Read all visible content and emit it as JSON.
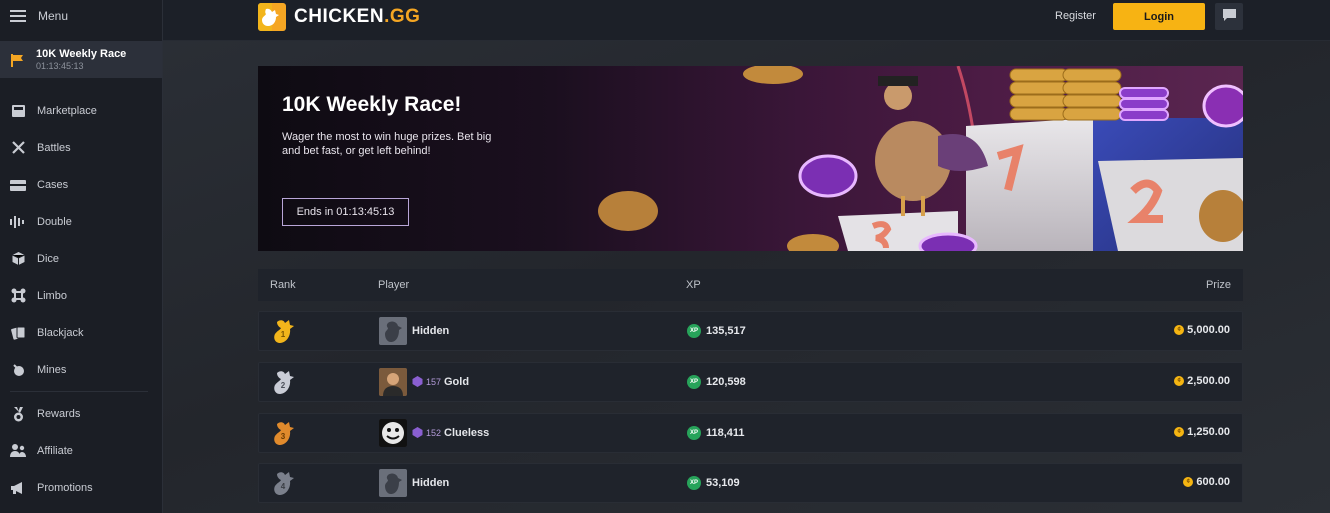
{
  "sidebar": {
    "menu_label": "Menu",
    "race": {
      "title": "10K Weekly Race",
      "timer": "01:13:45:13"
    },
    "items": [
      {
        "label": "Marketplace",
        "icon": "marketplace-icon"
      },
      {
        "label": "Battles",
        "icon": "swords-icon"
      },
      {
        "label": "Cases",
        "icon": "case-icon"
      },
      {
        "label": "Double",
        "icon": "bars-icon"
      },
      {
        "label": "Dice",
        "icon": "dice-icon"
      },
      {
        "label": "Limbo",
        "icon": "limbo-icon"
      },
      {
        "label": "Blackjack",
        "icon": "cards-icon"
      },
      {
        "label": "Mines",
        "icon": "mine-icon"
      }
    ],
    "items2": [
      {
        "label": "Rewards",
        "icon": "medal-icon"
      },
      {
        "label": "Affiliate",
        "icon": "people-icon"
      },
      {
        "label": "Promotions",
        "icon": "megaphone-icon"
      }
    ]
  },
  "header": {
    "logo_text": "CHICKEN",
    "logo_suffix": ".GG",
    "register_label": "Register",
    "login_label": "Login"
  },
  "banner": {
    "title": "10K Weekly Race!",
    "description": "Wager the most to win huge prizes. Bet big and bet fast, or get left behind!",
    "ends_label": "Ends in 01:13:45:13"
  },
  "leaderboard": {
    "columns": {
      "rank": "Rank",
      "player": "Player",
      "xp": "XP",
      "prize": "Prize"
    },
    "xp_badge": "XP",
    "rows": [
      {
        "rank": "1",
        "medal_color": "#f2b51b",
        "level": "",
        "player": "Hidden",
        "xp": "135,517",
        "prize": "5,000.00"
      },
      {
        "rank": "2",
        "medal_color": "#c9ccd6",
        "level": "157",
        "player": "Gold",
        "xp": "120,598",
        "prize": "2,500.00"
      },
      {
        "rank": "3",
        "medal_color": "#e08a2c",
        "level": "152",
        "player": "Clueless",
        "xp": "118,411",
        "prize": "1,250.00"
      },
      {
        "rank": "4",
        "medal_color": "#7b808c",
        "level": "",
        "player": "Hidden",
        "xp": "53,109",
        "prize": "600.00"
      }
    ]
  },
  "colors": {
    "accent": "#f7b313",
    "xp_green": "#27a35a",
    "level_purple": "#8a5fd1"
  }
}
